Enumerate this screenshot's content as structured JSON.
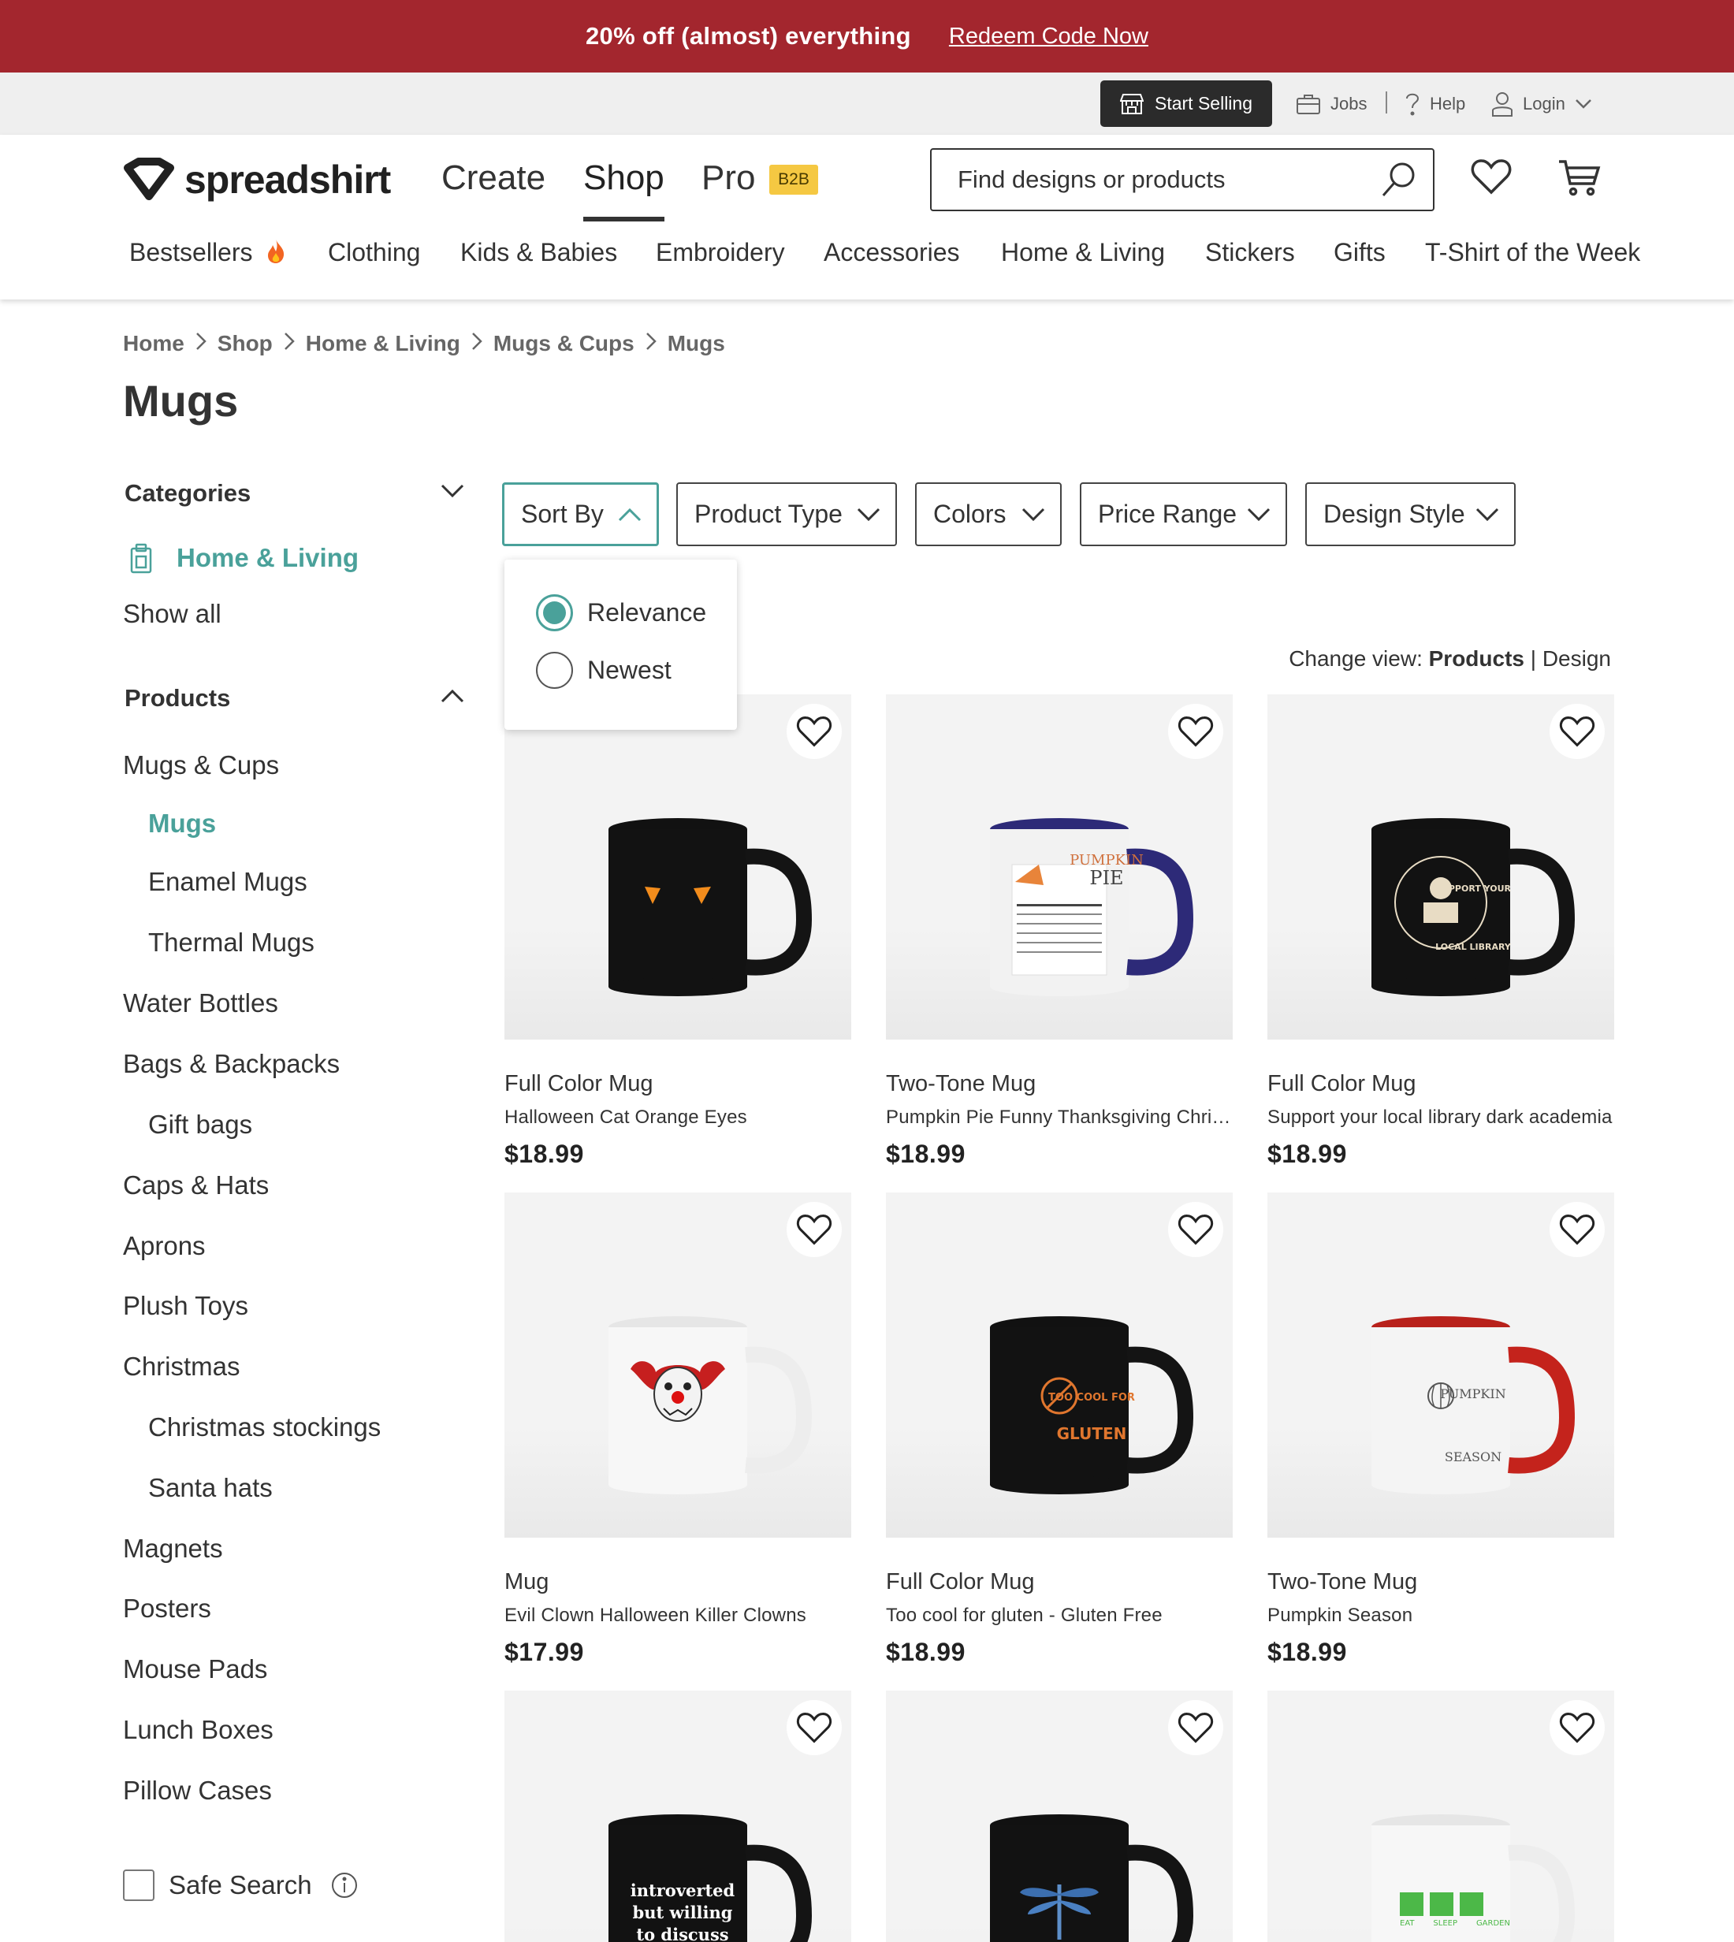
{
  "promo": {
    "text": "20% off (almost) everything",
    "link": "Redeem Code Now"
  },
  "utility": {
    "start_selling": "Start Selling",
    "jobs": "Jobs",
    "help": "Help",
    "login": "Login"
  },
  "header": {
    "logo": "spreadshirt",
    "nav": [
      "Create",
      "Shop",
      "Pro"
    ],
    "b2b": "B2B",
    "search_placeholder": "Find designs or products",
    "categories": [
      "Bestsellers",
      "Clothing",
      "Kids & Babies",
      "Embroidery",
      "Accessories",
      "Home & Living",
      "Stickers",
      "Gifts",
      "T-Shirt of the Week"
    ]
  },
  "breadcrumb": [
    "Home",
    "Shop",
    "Home & Living",
    "Mugs & Cups",
    "Mugs"
  ],
  "page_title": "Mugs",
  "sidebar": {
    "categories_heading": "Categories",
    "category_active": "Home & Living",
    "show_all": "Show all",
    "products_heading": "Products",
    "products": [
      "Mugs & Cups",
      "Mugs",
      "Enamel Mugs",
      "Thermal Mugs",
      "Water Bottles",
      "Bags & Backpacks",
      "Gift bags",
      "Caps & Hats",
      "Aprons",
      "Plush Toys",
      "Christmas",
      "Christmas stockings",
      "Santa hats",
      "Magnets",
      "Posters",
      "Mouse Pads",
      "Lunch Boxes",
      "Pillow Cases"
    ],
    "safe_search": "Safe Search"
  },
  "filters": {
    "buttons": [
      "Sort By",
      "Product Type",
      "Colors",
      "Price Range",
      "Design Style"
    ],
    "sort_options": [
      "Relevance",
      "Newest"
    ],
    "sort_selected": "Relevance"
  },
  "change_view": {
    "label": "Change view:",
    "products": "Products",
    "sep": "|",
    "design": "Design"
  },
  "products": [
    {
      "type": "Full Color Mug",
      "name": "Halloween Cat Orange Eyes",
      "price": "$18.99"
    },
    {
      "type": "Two-Tone Mug",
      "name": "Pumpkin Pie Funny Thanksgiving Christmas",
      "price": "$18.99"
    },
    {
      "type": "Full Color Mug",
      "name": "Support your local library dark academia",
      "price": "$18.99"
    },
    {
      "type": "Mug",
      "name": "Evil Clown Halloween Killer Clowns",
      "price": "$17.99"
    },
    {
      "type": "Full Color Mug",
      "name": "Too cool for gluten - Gluten Free",
      "price": "$18.99"
    },
    {
      "type": "Two-Tone Mug",
      "name": "Pumpkin Season",
      "price": "$18.99"
    }
  ],
  "mug_prints": {
    "p1": [
      "PUMPKIN",
      "PIE"
    ],
    "p2": [
      "SUPPORT YOUR",
      "LOCAL LIBRARY"
    ],
    "p4": [
      "TOO COOL FOR",
      "GLUTEN"
    ],
    "p5": [
      "PUMPKIN",
      "SEASON"
    ],
    "p6": [
      "introverted",
      "but willing",
      "to discuss"
    ],
    "p8": [
      "EAT",
      "SLEEP",
      "GARDEN"
    ]
  },
  "colors": {
    "promo": "#a3262e",
    "accent": "#4aa19a",
    "dark": "#2b2b2b",
    "b2b": "#f5c842"
  }
}
